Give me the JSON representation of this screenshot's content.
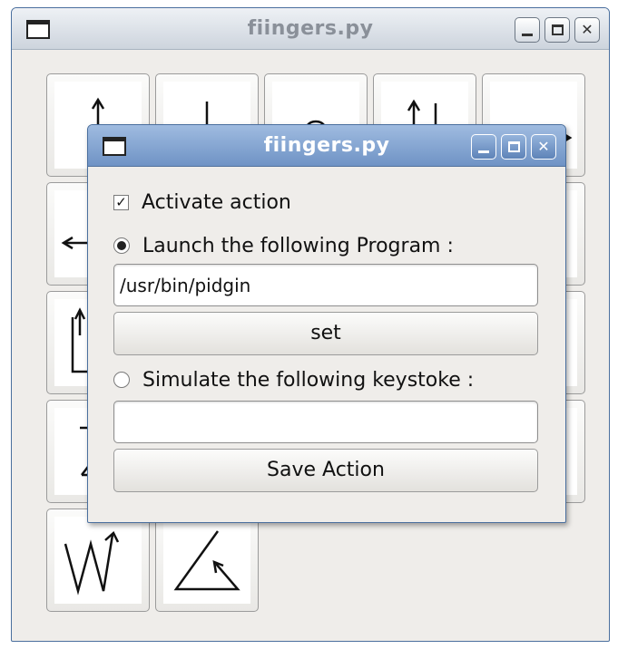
{
  "main_window": {
    "title": "fiingers.py",
    "icon": "window-icon",
    "controls": [
      "minimize-icon",
      "maximize-icon",
      "close-icon"
    ]
  },
  "gesture_grid": {
    "icons": [
      "gesture-up",
      "gesture-down",
      "gesture-up-down",
      "gesture-up-and-down",
      "gesture-right",
      "gesture-left",
      "gesture-hidden",
      "gesture-hidden",
      "gesture-hidden",
      "gesture-hidden",
      "gesture-square-up",
      "gesture-hidden",
      "gesture-hidden",
      "gesture-hidden",
      "gesture-hidden",
      "gesture-z",
      "gesture-hidden",
      "gesture-hidden",
      "gesture-hidden",
      "gesture-hidden",
      "gesture-w-up",
      "gesture-triangle"
    ]
  },
  "dialog": {
    "title": "fiingers.py",
    "controls": [
      "minimize-icon",
      "maximize-icon",
      "close-icon"
    ],
    "activate_action": {
      "label": "Activate action",
      "checked": true
    },
    "launch_program": {
      "label": "Launch the following Program :",
      "selected": true
    },
    "program_path": {
      "value": "/usr/bin/pidgin",
      "placeholder": ""
    },
    "set_button": "set",
    "simulate_keystroke": {
      "label": "Simulate the following keystoke :",
      "selected": false
    },
    "keystroke_value": {
      "value": "",
      "placeholder": ""
    },
    "save_button": "Save Action",
    "check_mark": "✓",
    "title_color": "#ffffff",
    "titlebar_color": "#7c9dcc"
  }
}
